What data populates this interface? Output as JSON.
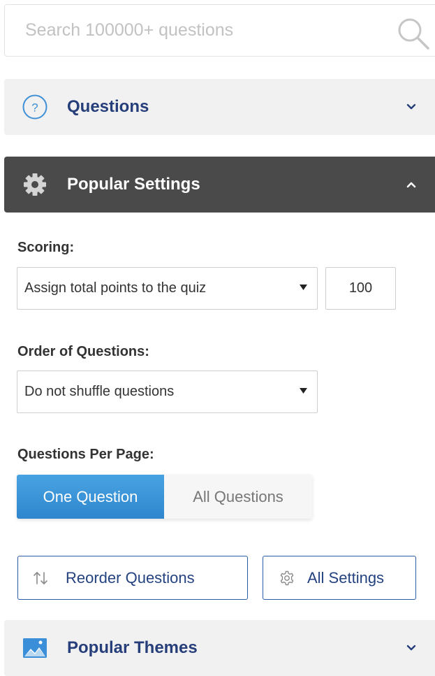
{
  "search": {
    "placeholder": "Search 100000+ questions",
    "icon": "search-icon"
  },
  "panels": {
    "questions": {
      "title": "Questions",
      "icon": "question-circle-icon",
      "state": "collapsed"
    },
    "popular_settings": {
      "title": "Popular Settings",
      "icon": "gear-icon",
      "state": "expanded"
    },
    "popular_themes": {
      "title": "Popular Themes",
      "icon": "image-icon",
      "state": "collapsed"
    }
  },
  "settings": {
    "scoring": {
      "label": "Scoring:",
      "selected": "Assign total points to the quiz",
      "points": "100"
    },
    "order": {
      "label": "Order of Questions:",
      "selected": "Do not shuffle questions"
    },
    "per_page": {
      "label": "Questions Per Page:",
      "options": [
        "One Question",
        "All Questions"
      ],
      "selected": "One Question"
    }
  },
  "actions": {
    "reorder": "Reorder Questions",
    "all_settings": "All Settings"
  },
  "colors": {
    "accent_blue": "#3d95d8",
    "title_navy": "#263e7a",
    "dark_header": "#4a4a4a",
    "panel_light": "#f1f1f1"
  }
}
